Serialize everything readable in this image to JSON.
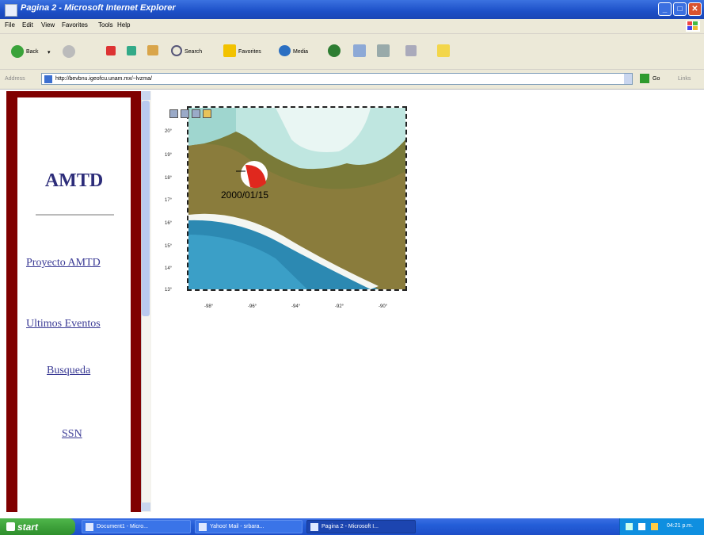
{
  "window": {
    "title": "Pagina 2 - Microsoft Internet Explorer"
  },
  "menu": {
    "items": [
      "File",
      "Edit",
      "View",
      "Favorites",
      "Tools",
      "Help"
    ]
  },
  "toolbar": {
    "back_label": "Back",
    "search_label": "Search",
    "favorites_label": "Favorites",
    "media_label": "Media"
  },
  "address": {
    "label": "Address",
    "url": "http://bevbnu.igeofcu.unam.mx/~lvzma/",
    "go_label": "Go",
    "links_label": "Links"
  },
  "sidebar": {
    "title": "AMTD",
    "links": [
      "Proyecto AMTD",
      "Ultimos Eventos",
      "Busqueda",
      "SSN"
    ]
  },
  "map": {
    "event_label": "2000/01/15",
    "y_ticks": [
      "20°",
      "19°",
      "18°",
      "17°",
      "16°",
      "15°",
      "14°",
      "13°"
    ],
    "x_ticks": [
      "-98°",
      "-96°",
      "-94°",
      "-92°",
      "-90°"
    ]
  },
  "taskbar": {
    "start_label": "start",
    "tasks": [
      "Document1 - Micro...",
      "Yahoo! Mail - srbara...",
      "Pagina 2 - Microsoft I..."
    ],
    "clock": "04:21 p.m."
  },
  "colors": {
    "sidebar_frame": "#800000",
    "link": "#3a3a95",
    "title": "#2d2d7a"
  }
}
